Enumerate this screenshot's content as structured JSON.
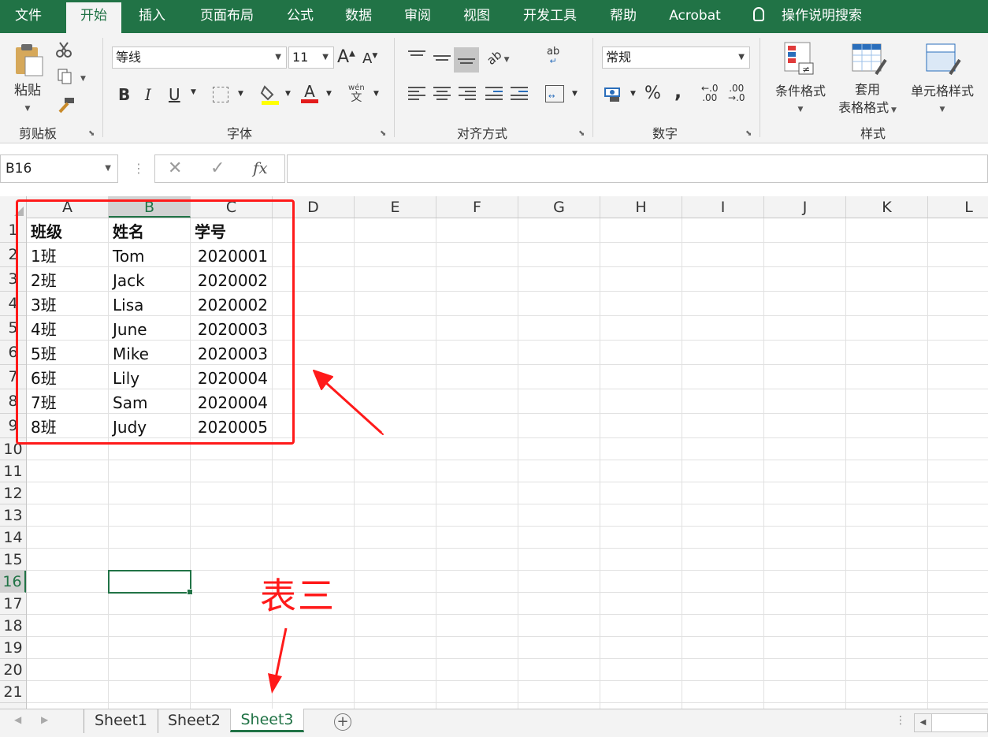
{
  "ribbon_tabs": [
    "文件",
    "开始",
    "插入",
    "页面布局",
    "公式",
    "数据",
    "审阅",
    "视图",
    "开发工具",
    "帮助",
    "Acrobat"
  ],
  "active_tab": "开始",
  "tell_me": "操作说明搜索",
  "clipboard": {
    "paste": "粘贴",
    "group": "剪贴板"
  },
  "font": {
    "name": "等线",
    "size": "11",
    "grow": "A",
    "shrink": "A",
    "bold": "B",
    "italic": "I",
    "underline": "U",
    "color_letter": "A",
    "phonetic_top": "wén",
    "phonetic_bottom": "文",
    "group": "字体"
  },
  "alignment": {
    "orientation": "ab",
    "group": "对齐方式"
  },
  "number": {
    "format": "常规",
    "percent": "%",
    "comma": ",",
    "inc_decimal_top": "←.0",
    "inc_decimal_bottom": ".00",
    "dec_decimal_top": ".00",
    "dec_decimal_bottom": "→.0",
    "group": "数字"
  },
  "styles": {
    "conditional": "条件格式",
    "table_1": "套用",
    "table_2": "表格格式",
    "cell_styles": "单元格样式",
    "group": "样式"
  },
  "formula_bar": {
    "name_box": "B16",
    "cancel": "✕",
    "enter": "✓",
    "fx": "fx",
    "content": ""
  },
  "columns": [
    "A",
    "B",
    "C",
    "D",
    "E",
    "F",
    "G",
    "H",
    "I",
    "J",
    "K",
    "L"
  ],
  "selected_column": "B",
  "rows": [
    "1",
    "2",
    "3",
    "4",
    "5",
    "6",
    "7",
    "8",
    "9",
    "10",
    "11",
    "12",
    "13",
    "14",
    "15",
    "16",
    "17",
    "18",
    "19",
    "20",
    "21"
  ],
  "selected_row": "16",
  "table": {
    "header": [
      "班级",
      "姓名",
      "学号"
    ],
    "rows": [
      [
        "1班",
        "Tom",
        "2020001"
      ],
      [
        "2班",
        "Jack",
        "2020002"
      ],
      [
        "3班",
        "Lisa",
        "2020002"
      ],
      [
        "4班",
        "June",
        "2020003"
      ],
      [
        "5班",
        "Mike",
        "2020003"
      ],
      [
        "6班",
        "Lily",
        "2020004"
      ],
      [
        "7班",
        "Sam",
        "2020004"
      ],
      [
        "8班",
        "Judy",
        "2020005"
      ]
    ]
  },
  "annotation": {
    "label": "表三",
    "color": "#ff1a1a"
  },
  "sheets": [
    "Sheet1",
    "Sheet2",
    "Sheet3"
  ],
  "active_sheet": "Sheet3",
  "colors": {
    "accent": "#217346",
    "ribbon_bg": "#f3f3f3"
  }
}
